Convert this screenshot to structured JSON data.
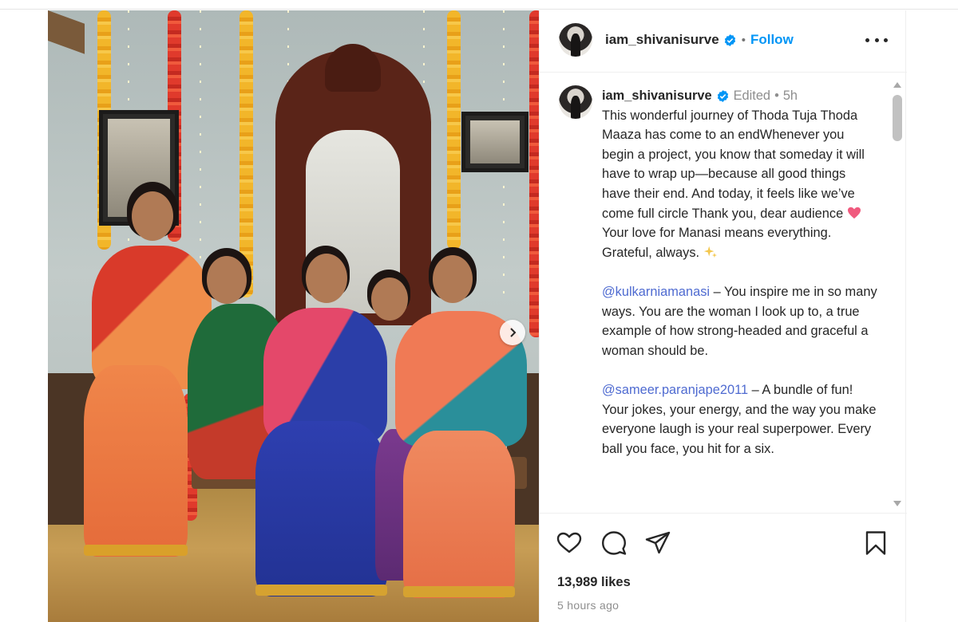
{
  "post": {
    "username": "iam_shivanisurve",
    "follow_label": "Follow",
    "separator": "•",
    "image_alt": "Five women in colorful traditional sarees posing on a wooden bench in front of an ornate mirror decorated with marigold garlands"
  },
  "caption": {
    "username": "iam_shivanisurve",
    "edited_label": "Edited",
    "separator": "•",
    "time": "5h",
    "para1_before_heart": "This wonderful journey of Thoda Tuja Thoda Maaza has come to an endWhenever you begin a project, you know that someday it will have to wrap up—because all good things have their end. And today, it feels like we’ve come full circle Thank you, dear audience",
    "para1_after_heart": "Your love for Manasi means everything. Grateful, always.",
    "mention1": "@kulkarniamanasi",
    "para2_text": " – You inspire me in so many ways. You are the woman I look up to, a true example of how strong-headed and graceful a woman should be.",
    "mention2": "@sameer.paranjape2011",
    "para3_text": " – A bundle of fun! Your jokes, your energy, and the way you make everyone laugh is your real superpower. Every ball you face, you hit for a six."
  },
  "stats": {
    "likes": "13,989 likes",
    "time_ago": "5 hours ago"
  },
  "icons": {
    "verified": "verified-badge-icon",
    "more": "more-options-icon",
    "like": "heart-icon",
    "comment": "comment-icon",
    "share": "paper-plane-icon",
    "save": "bookmark-icon",
    "next": "chevron-right-icon"
  },
  "colors": {
    "follow": "#0095f6",
    "mention": "#4f6bd1",
    "verified": "#0095f6",
    "muted": "#8e8e8e"
  }
}
